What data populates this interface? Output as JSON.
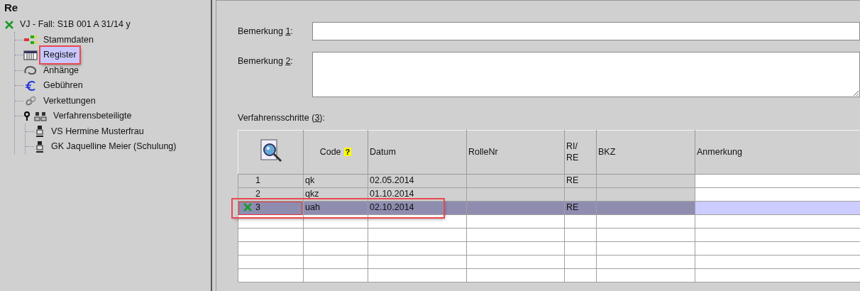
{
  "tree": {
    "title": "Re",
    "root": {
      "label": "VJ - Fall: S1B 001 A 31/14 y",
      "children": [
        {
          "label": "Stammdaten",
          "selected": false,
          "highlight": false
        },
        {
          "label": "Register",
          "selected": true,
          "highlight": true
        },
        {
          "label": "Anhänge",
          "selected": false,
          "highlight": false
        },
        {
          "label": "Gebühren",
          "selected": false,
          "highlight": false
        },
        {
          "label": "Verkettungen",
          "selected": false,
          "highlight": false
        },
        {
          "label": "Verfahrensbeteiligte",
          "selected": false,
          "highlight": false,
          "expanded": true,
          "children": [
            {
              "label": "VS Hermine Musterfrau",
              "selected": false,
              "highlight": false
            },
            {
              "label": "GK Jaquelline Meier (Schulung)",
              "selected": false,
              "highlight": false
            }
          ]
        }
      ]
    }
  },
  "form": {
    "fields": [
      {
        "label_parts": [
          "Bemerkung ",
          "1",
          ":"
        ],
        "kind": "line"
      },
      {
        "label_parts": [
          "Bemerkung ",
          "2",
          ":"
        ],
        "kind": "area"
      }
    ]
  },
  "table": {
    "label_parts": [
      "Verfahrensschritte (",
      "3",
      "):"
    ],
    "columns": [
      {
        "kind": "icon"
      },
      {
        "label": "Code",
        "help": "?"
      },
      {
        "label": "Datum"
      },
      {
        "label": "RolleNr"
      },
      {
        "label": "RI/\nRE"
      },
      {
        "label": "BKZ"
      },
      {
        "label": "Anmerkung"
      }
    ],
    "rows": [
      {
        "number": "1",
        "code": "qk",
        "datum": "02.05.2014",
        "ri_re": "RE",
        "selected": false,
        "marked": false,
        "highlight": false
      },
      {
        "number": "2",
        "code": "qkz",
        "datum": "01.10.2014",
        "selected": false,
        "marked": false,
        "highlight": false
      },
      {
        "number": "3",
        "code": "uah",
        "datum": "02.10.2014",
        "ri_re": "RE",
        "selected": true,
        "marked": true,
        "highlight": true
      }
    ]
  }
}
